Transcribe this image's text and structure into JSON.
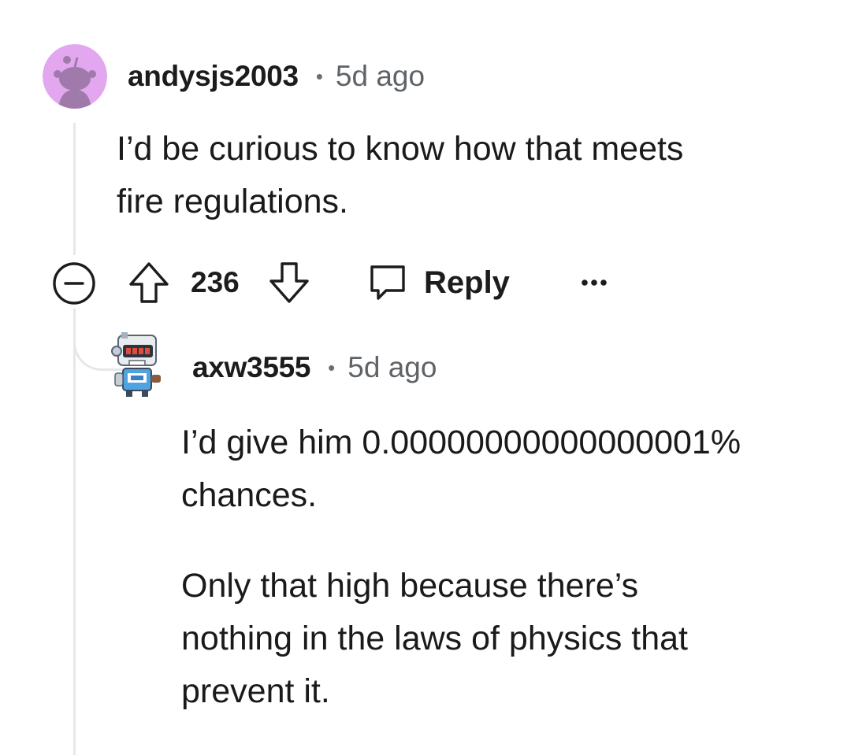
{
  "comments": [
    {
      "username": "andysjs2003",
      "separator": "•",
      "age": "5d ago",
      "avatar_icon": "snoo-avatar-icon",
      "avatar_color": "#e3a7f0",
      "body": [
        "I’d be curious to know how that meets\nfire regulations."
      ]
    },
    {
      "username": "axw3555",
      "separator": "•",
      "age": "5d ago",
      "avatar_icon": "robot-avatar-icon",
      "body": [
        "I’d give him 0.00000000000000001%\nchances.",
        "Only that high because there’s\nnothing in the laws of physics that\nprevent it."
      ]
    }
  ],
  "actions": {
    "collapse_icon": "collapse-minus-icon",
    "upvote_icon": "upvote-arrow-icon",
    "score": "236",
    "downvote_icon": "downvote-arrow-icon",
    "reply_icon": "speech-bubble-icon",
    "reply_label": "Reply",
    "more_icon": "more-options-icon"
  },
  "colors": {
    "thread_line": "#e5e7ea",
    "meta_gray": "#5f6368",
    "text": "#1a1a1b"
  }
}
